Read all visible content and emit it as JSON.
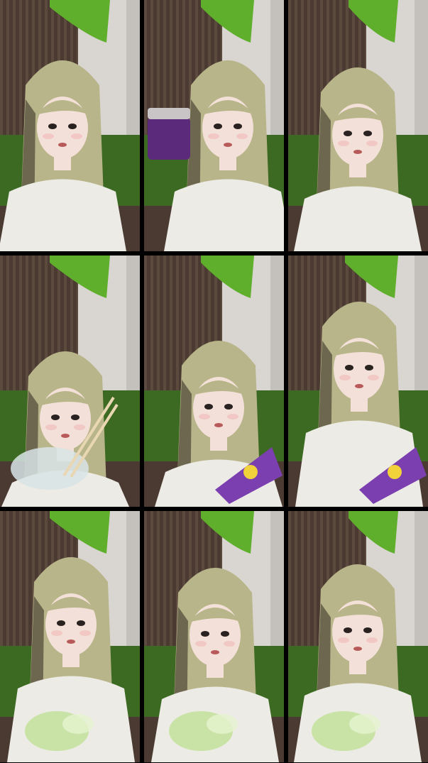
{
  "grid": {
    "rows": 3,
    "cols": 3,
    "frames": [
      {
        "pose": "talking",
        "prop": "none"
      },
      {
        "pose": "holding-jar",
        "prop": "jar"
      },
      {
        "pose": "smiling",
        "prop": "none"
      },
      {
        "pose": "eating-with-chopsticks",
        "prop": "bowl"
      },
      {
        "pose": "holding-snack-bag",
        "prop": "bag"
      },
      {
        "pose": "holding-snack-bag",
        "prop": "bag"
      },
      {
        "pose": "stretching-slime",
        "prop": "slime"
      },
      {
        "pose": "eyes-closed-holding-slime",
        "prop": "slime"
      },
      {
        "pose": "holding-slime",
        "prop": "slime"
      }
    ]
  },
  "colors": {
    "curtain": "#4a3a32",
    "curtain_stripe": "#6b5848",
    "wall": "#d9d6d2",
    "leaf": "#5fae2c",
    "sofa": "#3c6a22",
    "hair": "#b9b58a",
    "hair_dark": "#4d4636",
    "skin": "#f3e0d8",
    "shirt": "#ecebe5",
    "jar": "#5b2a7a",
    "bag": "#7b3fb0",
    "slime": "#c9e3a6",
    "bowl": "#d8e4e6"
  }
}
